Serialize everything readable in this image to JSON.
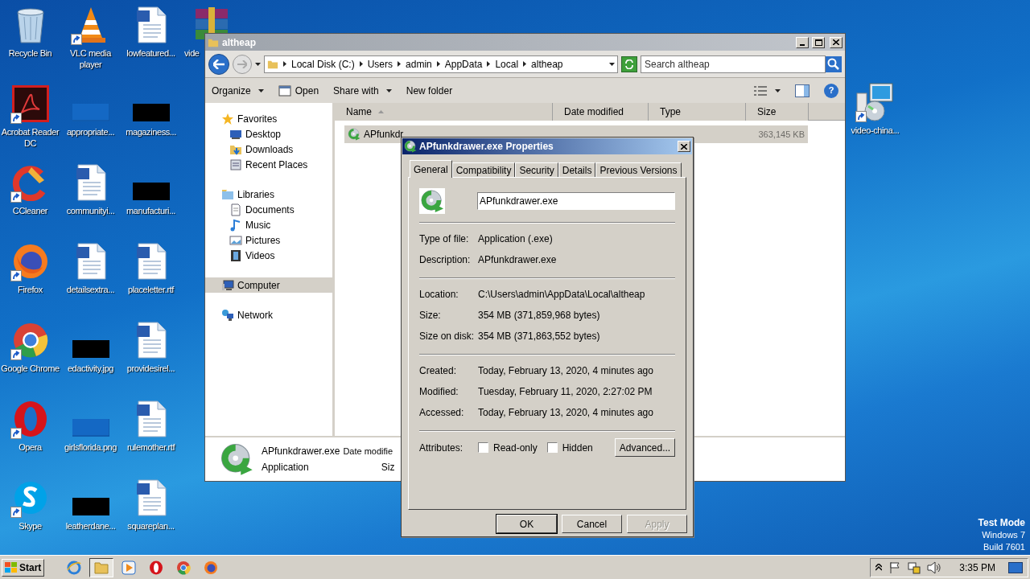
{
  "desktop": {
    "columns": [
      [
        {
          "label": "Recycle Bin",
          "kind": "recycle",
          "shortcut": false
        },
        {
          "label": "Acrobat Reader DC",
          "kind": "acrobat",
          "shortcut": true
        },
        {
          "label": "CCleaner",
          "kind": "ccleaner",
          "shortcut": true
        },
        {
          "label": "Firefox",
          "kind": "firefox",
          "shortcut": true
        },
        {
          "label": "Google Chrome",
          "kind": "chrome",
          "shortcut": true
        },
        {
          "label": "Opera",
          "kind": "opera",
          "shortcut": true
        },
        {
          "label": "Skype",
          "kind": "skype",
          "shortcut": true
        }
      ],
      [
        {
          "label": "VLC media player",
          "kind": "vlc",
          "shortcut": true
        },
        {
          "label": "appropriate...",
          "kind": "blank",
          "shortcut": false
        },
        {
          "label": "communityi...",
          "kind": "doc",
          "shortcut": false
        },
        {
          "label": "detailsextra...",
          "kind": "doc",
          "shortcut": false
        },
        {
          "label": "edactivity.jpg",
          "kind": "thumb",
          "shortcut": false
        },
        {
          "label": "girlsflorida.png",
          "kind": "blank",
          "shortcut": false
        },
        {
          "label": "leatherdane...",
          "kind": "thumb",
          "shortcut": false
        }
      ],
      [
        {
          "label": "lowfeatured...",
          "kind": "doc",
          "shortcut": false
        },
        {
          "label": "magaziness...",
          "kind": "thumb",
          "shortcut": false
        },
        {
          "label": "manufacturi...",
          "kind": "thumb",
          "shortcut": false
        },
        {
          "label": "placeletter.rtf",
          "kind": "doc",
          "shortcut": false
        },
        {
          "label": "providesirel...",
          "kind": "doc",
          "shortcut": false
        },
        {
          "label": "rulemother.rtf",
          "kind": "doc",
          "shortcut": false
        },
        {
          "label": "squareplan...",
          "kind": "doc",
          "shortcut": false
        }
      ],
      [
        {
          "label": "vide",
          "kind": "archive",
          "shortcut": false
        }
      ]
    ],
    "right_icons": [
      {
        "label": "video-china...",
        "kind": "installer",
        "shortcut": true
      }
    ]
  },
  "explorer": {
    "title": "altheap",
    "breadcrumb": [
      "Local Disk (C:)",
      "Users",
      "admin",
      "AppData",
      "Local",
      "altheap"
    ],
    "search": {
      "placeholder": "Search altheap"
    },
    "commands": [
      {
        "label": "Organize",
        "kind": "menu"
      },
      {
        "label": "Open",
        "kind": "open"
      },
      {
        "label": "Share with",
        "kind": "menu"
      },
      {
        "label": "New folder",
        "kind": "plain"
      }
    ],
    "help": "?",
    "nav": [
      {
        "label": "Favorites",
        "kind": "star",
        "selected": false,
        "children": [
          {
            "label": "Desktop",
            "kind": "desktop",
            "selected": false
          },
          {
            "label": "Downloads",
            "kind": "downloads",
            "selected": false
          },
          {
            "label": "Recent Places",
            "kind": "recent",
            "selected": false
          }
        ]
      },
      {
        "label": "Libraries",
        "kind": "libraries",
        "selected": false,
        "children": [
          {
            "label": "Documents",
            "kind": "documents",
            "selected": false
          },
          {
            "label": "Music",
            "kind": "music",
            "selected": false
          },
          {
            "label": "Pictures",
            "kind": "pictures",
            "selected": false
          },
          {
            "label": "Videos",
            "kind": "videos",
            "selected": false
          }
        ]
      },
      {
        "label": "Computer",
        "kind": "computer",
        "selected": true
      },
      {
        "label": "Network",
        "kind": "network",
        "selected": false
      }
    ],
    "columns": [
      {
        "label": "Name",
        "sorted": true
      },
      {
        "label": "Date modified",
        "sorted": false
      },
      {
        "label": "Type",
        "sorted": false
      },
      {
        "label": "Size",
        "sorted": false
      }
    ],
    "rows": [
      {
        "name": "APfunkdr",
        "size": "363,145 KB",
        "selected": true
      }
    ],
    "details": {
      "name": "APfunkdrawer.exe",
      "date_label": "Date modifie",
      "type": "Application",
      "size_label": "Siz"
    }
  },
  "properties": {
    "title": "APfunkdrawer.exe Properties",
    "tabs": [
      {
        "label": "General",
        "selected": true
      },
      {
        "label": "Compatibility",
        "selected": false
      },
      {
        "label": "Security",
        "selected": false
      },
      {
        "label": "Details",
        "selected": false
      },
      {
        "label": "Previous Versions",
        "selected": false
      }
    ],
    "filename": "APfunkdrawer.exe",
    "groups": [
      [
        {
          "label": "Type of file:",
          "value": "Application (.exe)"
        },
        {
          "label": "Description:",
          "value": "APfunkdrawer.exe"
        }
      ],
      [
        {
          "label": "Location:",
          "value": "C:\\Users\\admin\\AppData\\Local\\altheap"
        },
        {
          "label": "Size:",
          "value": "354 MB (371,859,968 bytes)"
        },
        {
          "label": "Size on disk:",
          "value": "354 MB (371,863,552 bytes)"
        }
      ],
      [
        {
          "label": "Created:",
          "value": "Today, February 13, 2020, 4 minutes ago"
        },
        {
          "label": "Modified:",
          "value": "Tuesday, February 11, 2020, 2:27:02 PM"
        },
        {
          "label": "Accessed:",
          "value": "Today, February 13, 2020, 4 minutes ago"
        }
      ]
    ],
    "attributes_label": "Attributes:",
    "attributes": [
      {
        "label": "Read-only",
        "checked": false
      },
      {
        "label": "Hidden",
        "checked": false
      }
    ],
    "advanced": "Advanced...",
    "buttons": [
      {
        "label": "OK",
        "default": true,
        "disabled": false
      },
      {
        "label": "Cancel",
        "default": false,
        "disabled": false
      },
      {
        "label": "Apply",
        "default": false,
        "disabled": true
      }
    ]
  },
  "taskbar": {
    "start": "Start",
    "apps": [
      {
        "kind": "ie",
        "active": false
      },
      {
        "kind": "folder",
        "active": true
      },
      {
        "kind": "media",
        "active": false
      },
      {
        "kind": "opera",
        "active": false
      },
      {
        "kind": "chrome",
        "active": false
      },
      {
        "kind": "firefox",
        "active": false
      }
    ],
    "time": "3:35 PM"
  },
  "test_mode": [
    "Test Mode",
    "Windows 7",
    "Build 7601"
  ]
}
